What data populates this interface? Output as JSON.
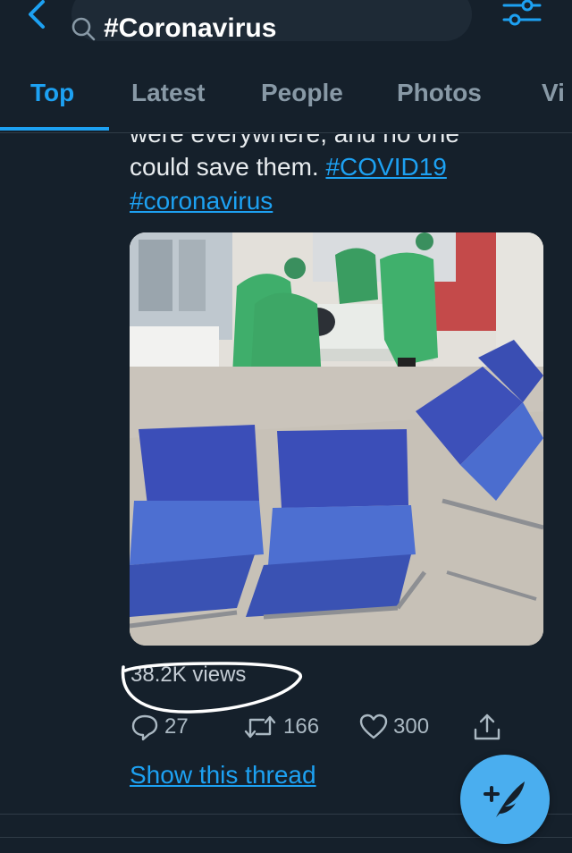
{
  "header": {
    "search_query": "#Coronavirus",
    "back_icon": "chevron-left-icon",
    "filter_icon": "sliders-icon"
  },
  "tabs": [
    {
      "label": "Top",
      "active": true
    },
    {
      "label": "Latest",
      "active": false
    },
    {
      "label": "People",
      "active": false
    },
    {
      "label": "Photos",
      "active": false
    },
    {
      "label": "Vi",
      "active": false
    }
  ],
  "tweet": {
    "clipped_line": "were everywhere, and no one",
    "line2_text": "could save them. ",
    "hashtag1": "#COVID19",
    "hashtag2": "#coronavirus",
    "views": "38.2K views",
    "replies": "27",
    "retweets": "166",
    "likes": "300",
    "show_thread": "Show this thread"
  },
  "colors": {
    "background": "#15202b",
    "accent": "#1da1f2",
    "muted": "#8899a6",
    "fab": "#4aaeef"
  },
  "fab": {
    "icon": "compose-feather-icon"
  }
}
